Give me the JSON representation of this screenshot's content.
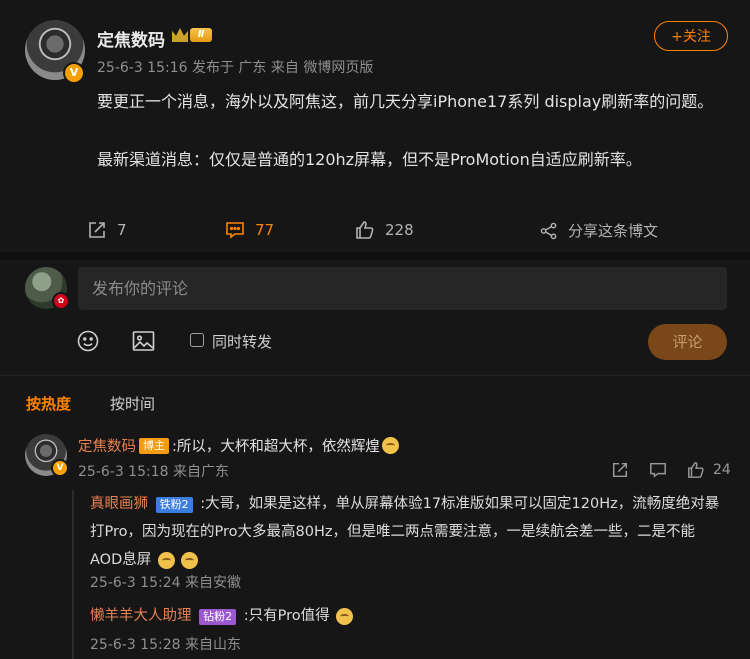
{
  "post": {
    "author": "定焦数码",
    "level": "Ⅱ",
    "meta": "25-6-3 15:16  发布于 广东  来自 微博网页版",
    "follow_label": "+关注",
    "text_line1": "要更正一个消息，海外以及阿焦这，前几天分享iPhone17系列 display刷新率的问题。",
    "text_line2": "最新渠道消息：仅仅是普通的120hz屏幕，但不是ProMotion自适应刷新率。"
  },
  "actions": {
    "repost_count": "7",
    "comment_count": "77",
    "like_count": "228",
    "share_label": "分享这条博文"
  },
  "compose": {
    "placeholder": "发布你的评论",
    "also_repost_label": "同时转发",
    "submit_label": "评论"
  },
  "tabs": {
    "hot": "按热度",
    "time": "按时间"
  },
  "comments": [
    {
      "user": "定焦数码",
      "tag": "博主",
      "text": ":所以，大杯和超大杯，依然辉煌",
      "meta": "25-6-3 15:18 来自广东",
      "likes": "24",
      "replies": [
        {
          "user": "真眼画狮",
          "tag": "铁粉2",
          "text": ":大哥，如果是这样，单从屏幕体验17标准版如果可以固定120Hz，流畅度绝对暴打Pro，因为现在的Pro大多最高80Hz，但是唯二两点需要注意，一是续航会差一些，二是不能AOD息屏",
          "meta": "25-6-3 15:24 来自安徽"
        },
        {
          "user": "懒羊羊大人助理",
          "tag": "钻粉2",
          "text": ":只有Pro值得",
          "meta": "25-6-3 15:28 来自山东"
        }
      ]
    }
  ],
  "colors": {
    "accent": "#ff8200",
    "background": "#161616",
    "username": "#e8804f"
  }
}
